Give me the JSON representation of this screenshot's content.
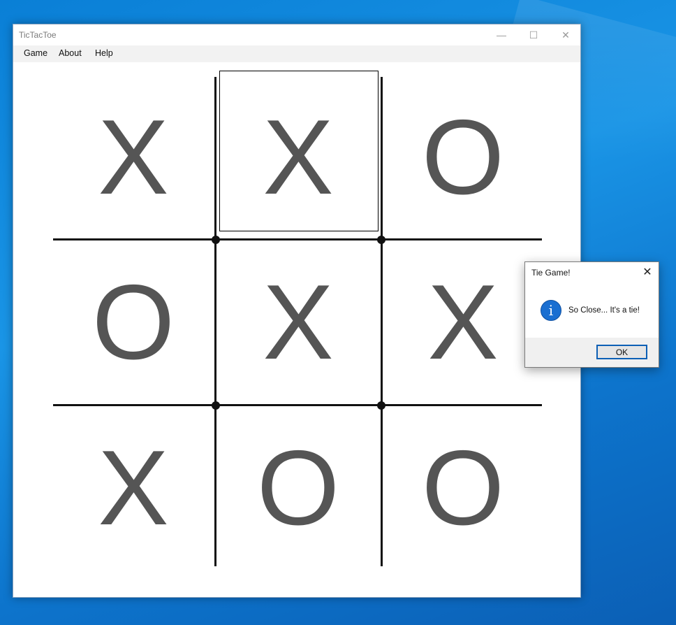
{
  "window": {
    "title": "TicTacToe",
    "controls": {
      "minimize": "—",
      "maximize": "☐",
      "close": "✕"
    }
  },
  "menu": [
    "Game",
    "About",
    "Help"
  ],
  "board": {
    "cells": [
      "X",
      "X",
      "O",
      "O",
      "X",
      "X",
      "X",
      "O",
      "O"
    ]
  },
  "dialog": {
    "title": "Tie Game!",
    "close": "✕",
    "icon": "information-icon",
    "icon_glyph": "i",
    "message": "So Close... It's a tie!",
    "ok_label": "OK"
  },
  "colors": {
    "mark": "#555555",
    "desktop": "#1a8ee0",
    "dialog_accent": "#0c5fb5"
  }
}
